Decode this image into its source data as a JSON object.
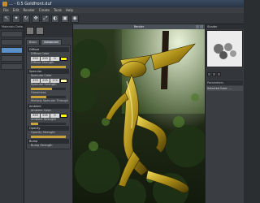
{
  "window": {
    "title": "... - 0.5 Goldfront.duf"
  },
  "menubar": {
    "items": [
      "File",
      "Edit",
      "Render",
      "Create",
      "Tools",
      "Help"
    ]
  },
  "left_panel": {
    "header": "Materials Default",
    "rows": [
      "",
      "",
      "",
      "",
      ""
    ]
  },
  "material_panel": {
    "tabs": [
      {
        "label": "Basic"
      },
      {
        "label": "Advanced"
      }
    ],
    "sections": {
      "diffuse": "Diffuse",
      "specular": "Specular",
      "ambient": "Ambient",
      "opacity": "Opacity",
      "bump": "Bump"
    },
    "labels": {
      "diffuse_color": "Diffuse Color",
      "diffuse_strength": "Diffuse Strength",
      "specular_color": "Specular Color",
      "specular_strength": "Specular Strength",
      "glossiness": "Glossiness",
      "multiply_specular": "Multiply Specular Through",
      "ambient_color": "Ambient Color",
      "ambient_strength": "Ambient Strength",
      "opacity_strength": "Opacity Strength",
      "bump_strength": "Bump Strength"
    },
    "diffuse_rgb": [
      "255",
      "255",
      "0"
    ],
    "specular_rgb": [
      "255",
      "255",
      "170"
    ],
    "ambient_rgb": [
      "255",
      "255",
      "0"
    ],
    "colors": {
      "diffuse": "#ffff00",
      "specular": "#ffffaa",
      "ambient": "#ffff00"
    }
  },
  "viewport": {
    "title": "Render"
  },
  "right_panel": {
    "header": "Shader",
    "params_header": "Parameters",
    "selected_label": "Selected Item: ...",
    "preview_bg": "#ececec"
  }
}
